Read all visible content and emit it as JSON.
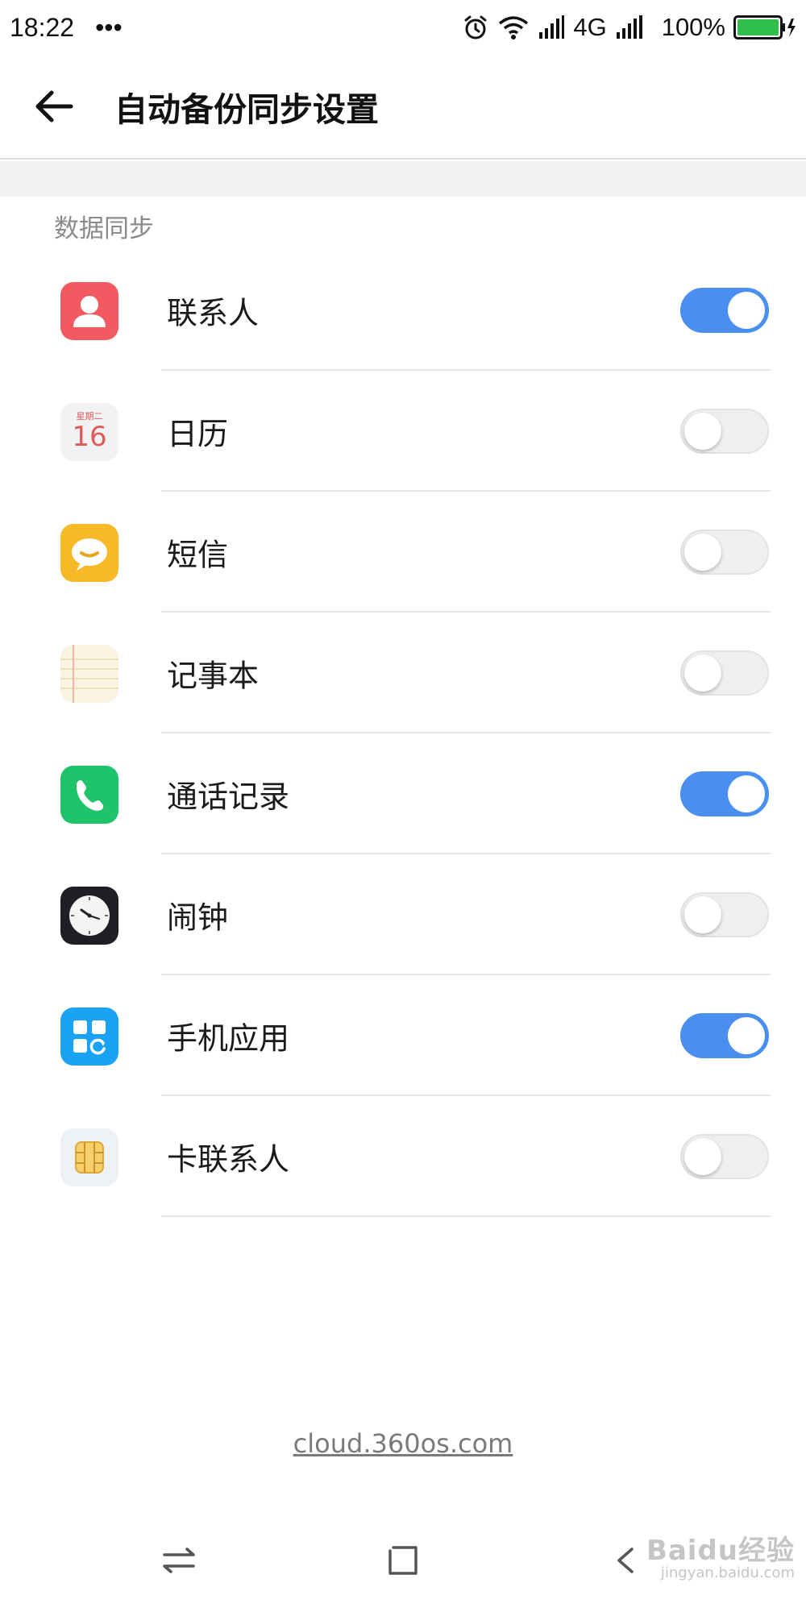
{
  "status_bar": {
    "time": "18:22",
    "more": "•••",
    "network": "4G",
    "battery": "100%",
    "battery_color": "#2fbf4a"
  },
  "header": {
    "title": "自动备份同步设置",
    "back_icon": "arrow-left-icon"
  },
  "section": {
    "label": "数据同步"
  },
  "items": [
    {
      "label": "联系人",
      "icon": "contacts-icon",
      "enabled": true
    },
    {
      "label": "日历",
      "icon": "calendar-icon",
      "enabled": false,
      "icon_weekday": "星期二",
      "icon_day": "16"
    },
    {
      "label": "短信",
      "icon": "messages-icon",
      "enabled": false
    },
    {
      "label": "记事本",
      "icon": "notepad-icon",
      "enabled": false
    },
    {
      "label": "通话记录",
      "icon": "phone-icon",
      "enabled": true
    },
    {
      "label": "闹钟",
      "icon": "clock-icon",
      "enabled": false
    },
    {
      "label": "手机应用",
      "icon": "apps-icon",
      "enabled": true
    },
    {
      "label": "卡联系人",
      "icon": "sim-card-icon",
      "enabled": false
    }
  ],
  "footer": {
    "link": "cloud.360os.com"
  },
  "watermark": {
    "brand": "Baidu经验",
    "url": "jingyan.baidu.com"
  },
  "colors": {
    "toggle_on": "#4a8ff0",
    "toggle_off": "#efefef"
  }
}
